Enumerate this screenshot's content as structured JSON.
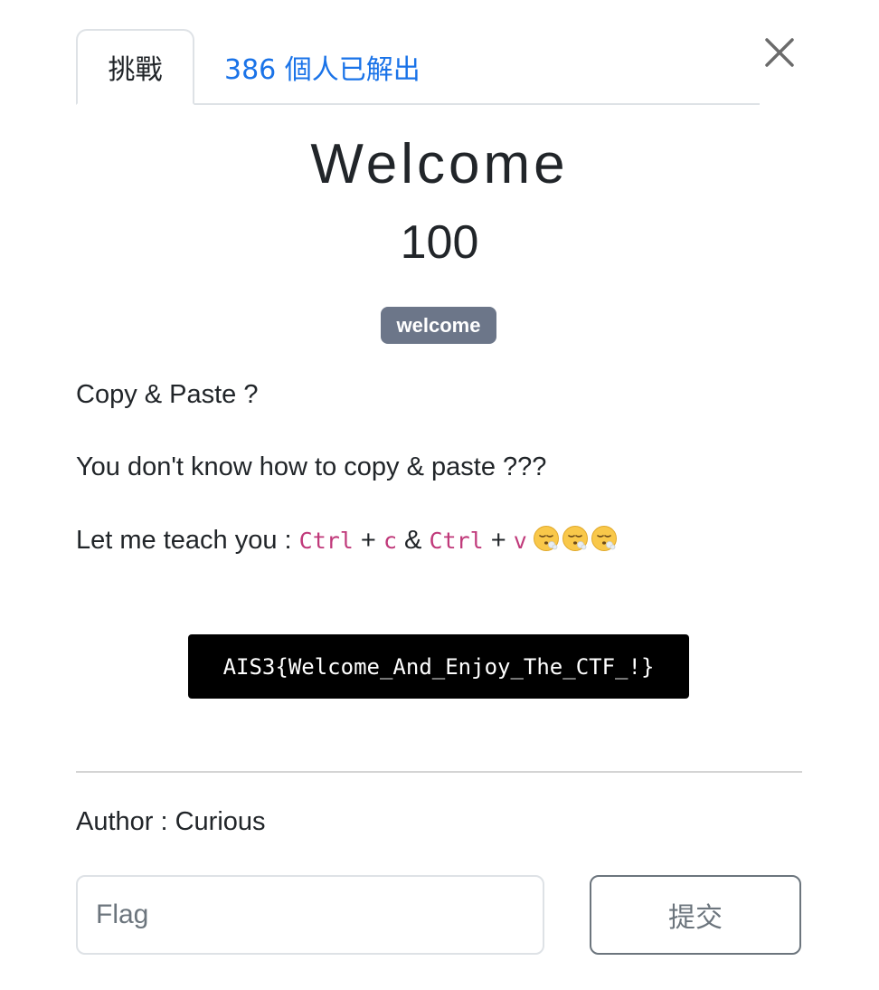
{
  "tabs": {
    "challenge_label": "挑戰",
    "solves_label": "386 個人已解出"
  },
  "icons": {
    "close": "close-icon",
    "emoji": "exhaling-face-emoji"
  },
  "challenge": {
    "name": "Welcome",
    "value": "100",
    "tag": "welcome",
    "description": {
      "line1": "Copy & Paste ?",
      "line2": "You don't know how to copy & paste ???",
      "line3_prefix": "Let me teach you : ",
      "key_ctrl_1": "Ctrl",
      "plus_1": " + ",
      "key_c": "c",
      "amp": " & ",
      "key_ctrl_2": "Ctrl",
      "plus_2": " + ",
      "key_v": "v"
    },
    "flag_text": "AIS3{Welcome_And_Enjoy_The_CTF_!}",
    "author": "Author : Curious"
  },
  "form": {
    "flag_placeholder": "Flag",
    "submit_label": "提交"
  },
  "colors": {
    "link": "#1a73e8",
    "tag_bg": "#6c7689",
    "code_pink": "#c0397a",
    "flag_bg": "#000000"
  }
}
